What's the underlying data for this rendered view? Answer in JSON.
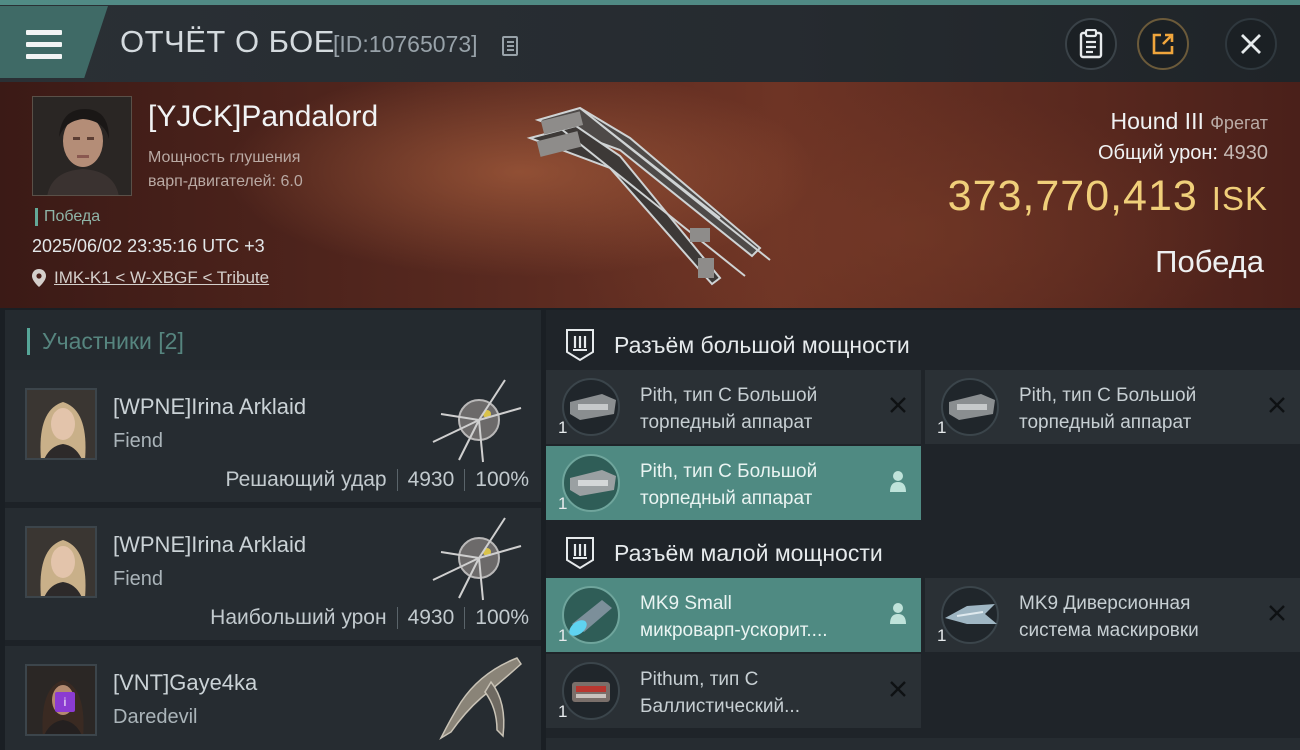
{
  "header": {
    "title": "ОТЧЁТ О БОЕ",
    "report_id": "[ID:10765073]"
  },
  "hero": {
    "pilot_name": "[YJCK]Pandalord",
    "stat_line1": "Мощность глушения",
    "stat_line2": "варп-двигателей: 6.0",
    "victory_tag": "Победа",
    "datetime": "2025/06/02 23:35:16 UTC +3",
    "location": "IMK-K1 < W-XBGF < Tribute",
    "ship_name": "Hound III",
    "ship_type": "Фрегат",
    "damage_label": "Общий урон:",
    "damage_value": "4930",
    "isk_value": "373,770,413",
    "isk_unit": "ISK",
    "result": "Победа"
  },
  "participants": {
    "title": "Участники [2]",
    "items": [
      {
        "name": "[WPNE]Irina Arklaid",
        "ship": "Fiend",
        "role": "Решающий удар",
        "damage": "4930",
        "percent": "100%"
      },
      {
        "name": "[WPNE]Irina Arklaid",
        "ship": "Fiend",
        "role": "Наибольший урон",
        "damage": "4930",
        "percent": "100%"
      },
      {
        "name": "[VNT]Gaye4ka",
        "ship": "Daredevil",
        "badge": "i"
      }
    ]
  },
  "slots": {
    "high": {
      "title": "Разъём большой мощности",
      "modules": [
        {
          "line1": "Pith, тип C Большой",
          "line2": "торпедный аппарат",
          "count": "1"
        },
        {
          "line1": "Pith, тип C Большой",
          "line2": "торпедный аппарат",
          "count": "1"
        },
        {
          "line1": "Pith, тип C Большой",
          "line2": "торпедный аппарат",
          "count": "1"
        }
      ]
    },
    "low": {
      "title": "Разъём малой мощности",
      "modules": [
        {
          "line1": "MK9 Small",
          "line2": "микроварп-ускорит....",
          "count": "1"
        },
        {
          "line1": "MK9 Диверсионная",
          "line2": "система маскировки",
          "count": "1"
        },
        {
          "line1": "Pithum, тип C",
          "line2": "Баллистический...",
          "count": "1"
        }
      ]
    }
  },
  "colors": {
    "accent": "#4f8a82",
    "isk": "#f0cf7a",
    "badge": "#8b3bd1"
  }
}
